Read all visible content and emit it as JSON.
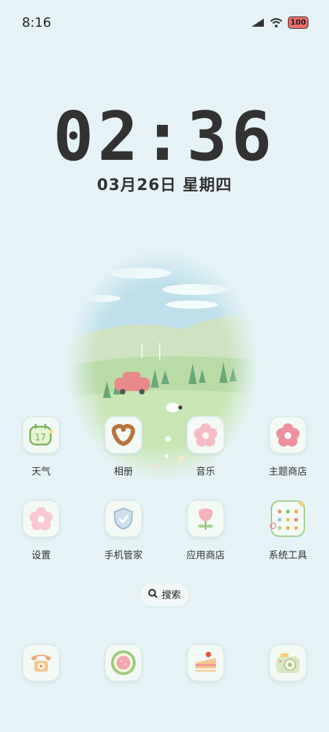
{
  "status_bar": {
    "time": "8:16",
    "battery": "100"
  },
  "clock": {
    "time": "02:36",
    "date": "03月26日 星期四"
  },
  "apps": [
    {
      "name": "weather",
      "label": "天气",
      "icon": "weather-calendar-icon",
      "text": "17"
    },
    {
      "name": "gallery",
      "label": "相册",
      "icon": "pretzel-icon"
    },
    {
      "name": "music",
      "label": "音乐",
      "icon": "pink-flower-icon"
    },
    {
      "name": "theme-store",
      "label": "主题商店",
      "icon": "donut-flower-icon"
    },
    {
      "name": "settings",
      "label": "设置",
      "icon": "flower-icon"
    },
    {
      "name": "phone-manager",
      "label": "手机管家",
      "icon": "shield-icon"
    },
    {
      "name": "app-store",
      "label": "应用商店",
      "icon": "tulip-icon"
    },
    {
      "name": "system-tools",
      "label": "系统工具",
      "icon": "folder-icon"
    }
  ],
  "search": {
    "label": "搜索",
    "icon": "search-icon"
  },
  "dock": [
    {
      "name": "phone",
      "icon": "telephone-icon"
    },
    {
      "name": "messages",
      "icon": "fruit-slice-icon"
    },
    {
      "name": "browser",
      "icon": "cake-icon"
    },
    {
      "name": "camera",
      "icon": "camera-icon"
    }
  ],
  "colors": {
    "background": "#e6f3f6",
    "battery": "#ef6b6b"
  }
}
